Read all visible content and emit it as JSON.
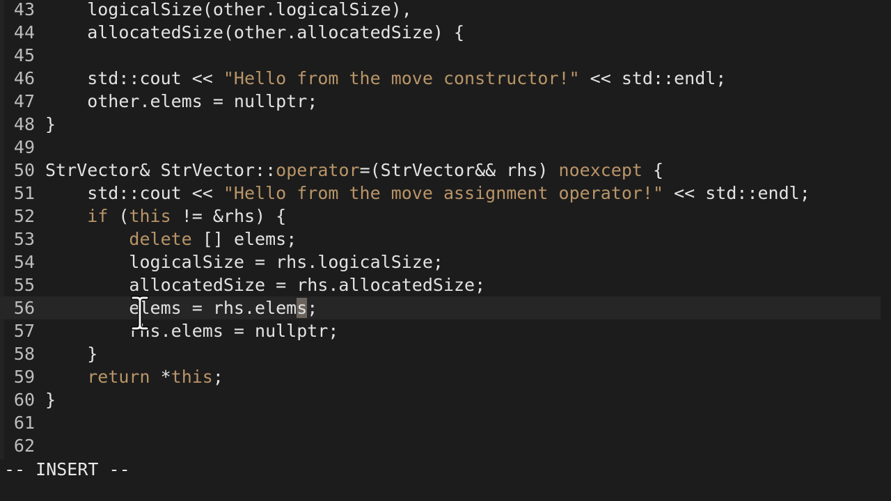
{
  "editor": {
    "mode": "-- INSERT --",
    "current_line": "56",
    "colors": {
      "background": "#1c1c1c",
      "text": "#e3e3e3",
      "keyword": "#b99568",
      "line_number": "#bdbdbd",
      "cursor_line": "#262626"
    },
    "lines": [
      {
        "num": "43",
        "tokens": [
          {
            "t": "    logicalSize(other.logicalSize),",
            "k": "plain"
          }
        ]
      },
      {
        "num": "44",
        "tokens": [
          {
            "t": "    allocatedSize(other.allocatedSize) {",
            "k": "plain"
          }
        ]
      },
      {
        "num": "45",
        "tokens": []
      },
      {
        "num": "46",
        "tokens": [
          {
            "t": "    std::cout << ",
            "k": "plain"
          },
          {
            "t": "\"Hello from the move constructor!\"",
            "k": "string"
          },
          {
            "t": " << std::endl;",
            "k": "plain"
          }
        ]
      },
      {
        "num": "47",
        "tokens": [
          {
            "t": "    other.elems = nullptr;",
            "k": "plain"
          }
        ]
      },
      {
        "num": "48",
        "tokens": [
          {
            "t": "}",
            "k": "plain"
          }
        ]
      },
      {
        "num": "49",
        "tokens": []
      },
      {
        "num": "50",
        "tokens": [
          {
            "t": "StrVector& StrVector::",
            "k": "plain"
          },
          {
            "t": "operator",
            "k": "keyword"
          },
          {
            "t": "=(StrVector&& rhs) ",
            "k": "plain"
          },
          {
            "t": "noexcept",
            "k": "keyword"
          },
          {
            "t": " {",
            "k": "plain"
          }
        ]
      },
      {
        "num": "51",
        "tokens": [
          {
            "t": "    std::cout << ",
            "k": "plain"
          },
          {
            "t": "\"Hello from the move assignment operator!\"",
            "k": "string"
          },
          {
            "t": " << std::endl;",
            "k": "plain"
          }
        ]
      },
      {
        "num": "52",
        "tokens": [
          {
            "t": "    ",
            "k": "plain"
          },
          {
            "t": "if",
            "k": "keyword"
          },
          {
            "t": " (",
            "k": "plain"
          },
          {
            "t": "this",
            "k": "keyword"
          },
          {
            "t": " != &rhs) {",
            "k": "plain"
          }
        ]
      },
      {
        "num": "53",
        "tokens": [
          {
            "t": "        ",
            "k": "plain"
          },
          {
            "t": "delete",
            "k": "keyword"
          },
          {
            "t": " [] elems;",
            "k": "plain"
          }
        ]
      },
      {
        "num": "54",
        "tokens": [
          {
            "t": "        logicalSize = rhs.logicalSize;",
            "k": "plain"
          }
        ]
      },
      {
        "num": "55",
        "tokens": [
          {
            "t": "        allocatedSize = rhs.allocatedSize;",
            "k": "plain"
          }
        ]
      },
      {
        "num": "56",
        "tokens": [
          {
            "t": "        elems = rhs.elem",
            "k": "plain"
          },
          {
            "t": "s",
            "k": "cursor"
          },
          {
            "t": ";",
            "k": "plain"
          }
        ]
      },
      {
        "num": "57",
        "tokens": [
          {
            "t": "        rhs.elems = nullptr;",
            "k": "plain"
          }
        ]
      },
      {
        "num": "58",
        "tokens": [
          {
            "t": "    }",
            "k": "plain"
          }
        ]
      },
      {
        "num": "59",
        "tokens": [
          {
            "t": "    ",
            "k": "plain"
          },
          {
            "t": "return",
            "k": "keyword"
          },
          {
            "t": " *",
            "k": "plain"
          },
          {
            "t": "this",
            "k": "keyword"
          },
          {
            "t": ";",
            "k": "plain"
          }
        ]
      },
      {
        "num": "60",
        "tokens": [
          {
            "t": "}",
            "k": "plain"
          }
        ]
      },
      {
        "num": "61",
        "tokens": []
      },
      {
        "num": "62",
        "tokens": []
      }
    ],
    "pointer_icon": "text-cursor-ibeam-icon"
  }
}
